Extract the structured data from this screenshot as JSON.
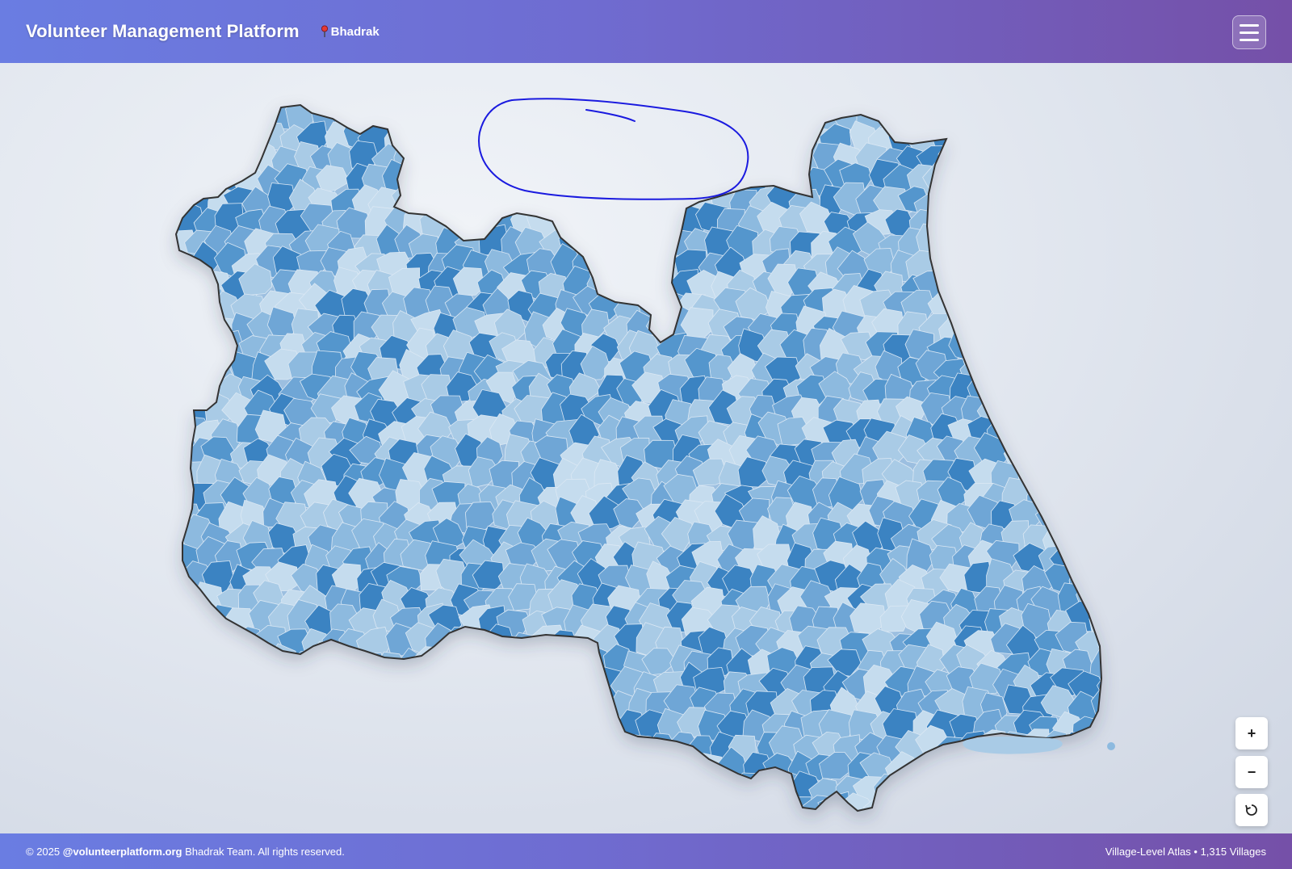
{
  "header": {
    "title": "Volunteer Management Platform",
    "location": "Bhadrak",
    "location_icon": "pin-icon",
    "menu_icon": "hamburger-menu-icon"
  },
  "map": {
    "boundary_color": "#333333",
    "fill_palette": [
      "#c5dcee",
      "#a9cbe6",
      "#8dbadf",
      "#6fa6d6",
      "#5496cd",
      "#3b83c2"
    ],
    "annotation_color": "#1a1adf"
  },
  "controls": {
    "zoom_in": "+",
    "zoom_out": "−",
    "reset_icon": "reset-icon"
  },
  "footer": {
    "copyright_prefix": "© 2025",
    "org": "@volunteerplatform.org",
    "copyright_suffix": "Bhadrak Team. All rights reserved.",
    "atlas_info": "Village-Level Atlas • 1,315 Villages"
  }
}
